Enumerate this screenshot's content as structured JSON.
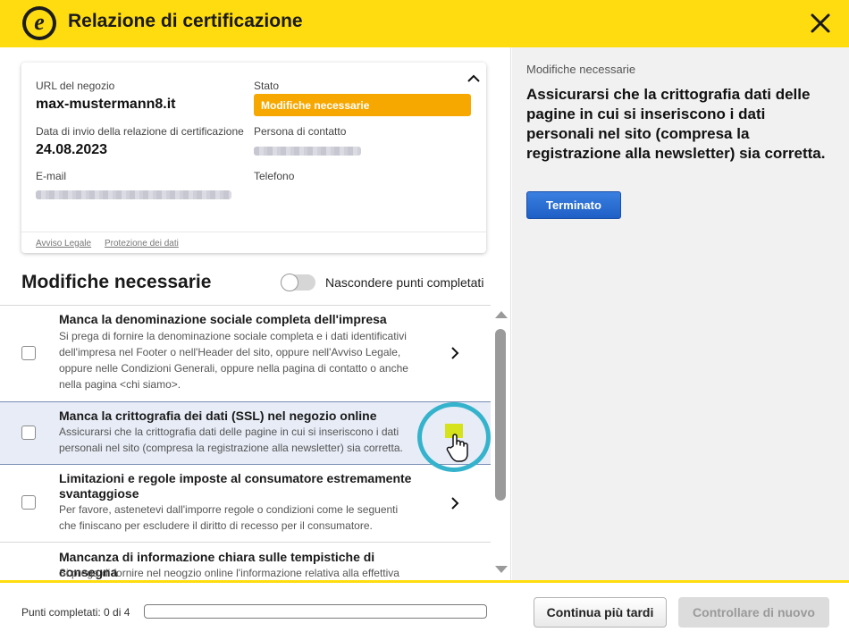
{
  "header": {
    "logo_letter": "e",
    "title": "Relazione di certificazione"
  },
  "card": {
    "shop_url_label": "URL del negozio",
    "shop_url": "max-mustermann8.it",
    "status_label": "Stato",
    "status_value": "Modifiche necessarie",
    "date_label": "Data di invio della relazione di certificazione",
    "date_value": "24.08.2023",
    "contact_label": "Persona di contatto",
    "email_label": "E-mail",
    "phone_label": "Telefono",
    "footer_links": [
      "Avviso Legale",
      "Protezione dei dati"
    ]
  },
  "section": {
    "title": "Modifiche necessarie",
    "toggle_label": "Nascondere punti completati",
    "toggle_on": false
  },
  "items": [
    {
      "title": "Manca la denominazione sociale completa dell'impresa",
      "desc": "Si prega di fornire la denominazione sociale completa e i dati identificativi dell'impresa nel Footer o nell'Header del sito, oppure nell'Avviso Legale, oppure nelle Condizioni Generali, oppure nella pagina di contatto o anche nella pagina <chi siamo>.",
      "checked": false
    },
    {
      "title": "Manca la crittografia dei dati (SSL) nel negozio online",
      "desc": "Assicurarsi che la crittografia dati delle pagine in cui si inseriscono i dati personali nel sito (compresa la registrazione alla newsletter) sia corretta.",
      "checked": false
    },
    {
      "title": "Limitazioni e regole imposte al consumatore estremamente svantaggiose",
      "desc": "Per favore, astenetevi dall'imporre regole o condizioni come le seguenti che finiscano per escludere il diritto di recesso per il consumatore.",
      "checked": false
    },
    {
      "title": "Mancanza di informazione chiara sulle tempistiche di consegna",
      "desc": "Si prega di fornire nel neogzio online l'informazione relativa alla effettiva",
      "checked": false
    }
  ],
  "detail": {
    "label": "Modifiche necessarie",
    "heading": "Assicurarsi che la crittografia dati delle pagine in cui si inseriscono i dati personali nel sito (compresa la registrazione alla newsletter) sia corretta.",
    "done_button": "Terminato"
  },
  "footer": {
    "progress_label": "Punti completati: 0 di 4",
    "progress_fraction": 0,
    "later_button": "Continua più tardi",
    "recheck_button": "Controllare di nuovo"
  },
  "colors": {
    "brand_yellow": "#ffdc0f",
    "status_orange": "#f6a800",
    "primary_blue": "#2a6fd6",
    "highlight_cyan": "#35b3cc"
  }
}
